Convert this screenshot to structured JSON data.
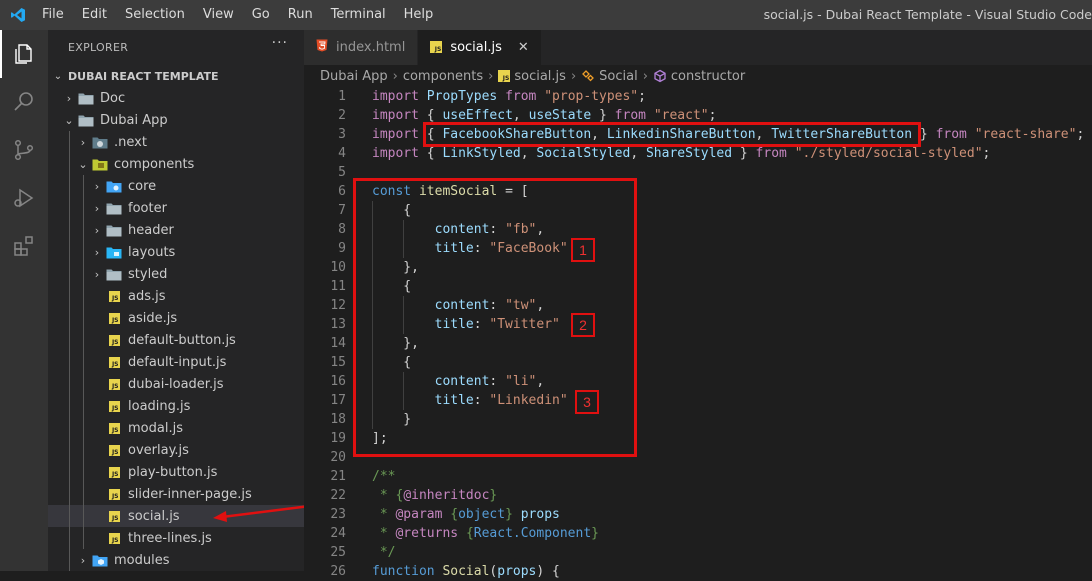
{
  "menu": [
    "File",
    "Edit",
    "Selection",
    "View",
    "Go",
    "Run",
    "Terminal",
    "Help"
  ],
  "window_title": "social.js - Dubai React Template - Visual Studio Code",
  "activity_icons": [
    "explorer-icon",
    "search-icon",
    "source-control-icon",
    "run-debug-icon",
    "extensions-icon"
  ],
  "explorer": {
    "title": "EXPLORER",
    "more": "···",
    "project": "DUBAI REACT TEMPLATE",
    "items": [
      {
        "label": "Doc",
        "type": "folder",
        "level": 0,
        "expanded": false
      },
      {
        "label": "Dubai App",
        "type": "folder",
        "level": 0,
        "expanded": true
      },
      {
        "label": ".next",
        "type": "folder-special",
        "level": 1,
        "expanded": false
      },
      {
        "label": "components",
        "type": "folder-components",
        "level": 1,
        "expanded": true
      },
      {
        "label": "core",
        "type": "folder-core",
        "level": 2,
        "expanded": false
      },
      {
        "label": "footer",
        "type": "folder",
        "level": 2,
        "expanded": false
      },
      {
        "label": "header",
        "type": "folder",
        "level": 2,
        "expanded": false
      },
      {
        "label": "layouts",
        "type": "folder-layouts",
        "level": 2,
        "expanded": false
      },
      {
        "label": "styled",
        "type": "folder",
        "level": 2,
        "expanded": false
      },
      {
        "label": "ads.js",
        "type": "js",
        "level": 2
      },
      {
        "label": "aside.js",
        "type": "js",
        "level": 2
      },
      {
        "label": "default-button.js",
        "type": "js",
        "level": 2
      },
      {
        "label": "default-input.js",
        "type": "js",
        "level": 2
      },
      {
        "label": "dubai-loader.js",
        "type": "js",
        "level": 2
      },
      {
        "label": "loading.js",
        "type": "js",
        "level": 2
      },
      {
        "label": "modal.js",
        "type": "js",
        "level": 2
      },
      {
        "label": "overlay.js",
        "type": "js",
        "level": 2
      },
      {
        "label": "play-button.js",
        "type": "js",
        "level": 2
      },
      {
        "label": "slider-inner-page.js",
        "type": "js",
        "level": 2
      },
      {
        "label": "social.js",
        "type": "js",
        "level": 2,
        "selected": true
      },
      {
        "label": "three-lines.js",
        "type": "js",
        "level": 2
      },
      {
        "label": "modules",
        "type": "folder-modules",
        "level": 1,
        "expanded": false
      }
    ]
  },
  "tabs": [
    {
      "label": "index.html",
      "icon": "html-icon",
      "active": false
    },
    {
      "label": "social.js",
      "icon": "js-icon",
      "active": true,
      "close": "✕"
    }
  ],
  "breadcrumbs": [
    {
      "label": "Dubai App",
      "icon": ""
    },
    {
      "label": "components",
      "icon": ""
    },
    {
      "label": "social.js",
      "icon": "js-icon"
    },
    {
      "label": "Social",
      "icon": "symbol-class-icon"
    },
    {
      "label": "constructor",
      "icon": "symbol-method-icon"
    }
  ],
  "code": [
    {
      "n": "1",
      "i": 0,
      "t": [
        [
          "kw",
          "import "
        ],
        [
          "vr",
          "PropTypes "
        ],
        [
          "kw",
          "from "
        ],
        [
          "st",
          "\"prop-types\""
        ],
        [
          "pn",
          ";"
        ]
      ]
    },
    {
      "n": "2",
      "i": 0,
      "t": [
        [
          "kw",
          "import "
        ],
        [
          "pn",
          "{ "
        ],
        [
          "vr",
          "useEffect"
        ],
        [
          "pn",
          ", "
        ],
        [
          "vr",
          "useState "
        ],
        [
          "pn",
          "} "
        ],
        [
          "kw",
          "from "
        ],
        [
          "st",
          "\"react\""
        ],
        [
          "pn",
          ";"
        ]
      ]
    },
    {
      "n": "3",
      "i": 0,
      "t": [
        [
          "kw",
          "import "
        ],
        [
          "pn",
          "{ "
        ],
        [
          "vr",
          "FacebookShareButton"
        ],
        [
          "pn",
          ", "
        ],
        [
          "vr",
          "LinkedinShareButton"
        ],
        [
          "pn",
          ", "
        ],
        [
          "vr",
          "TwitterShareButton "
        ],
        [
          "pn",
          "} "
        ],
        [
          "kw",
          "from "
        ],
        [
          "st",
          "\"react-share\""
        ],
        [
          "pn",
          ";"
        ]
      ]
    },
    {
      "n": "4",
      "i": 0,
      "t": [
        [
          "kw",
          "import "
        ],
        [
          "pn",
          "{ "
        ],
        [
          "vr",
          "LinkStyled"
        ],
        [
          "pn",
          ", "
        ],
        [
          "vr",
          "SocialStyled"
        ],
        [
          "pn",
          ", "
        ],
        [
          "vr",
          "ShareStyled "
        ],
        [
          "pn",
          "} "
        ],
        [
          "kw",
          "from "
        ],
        [
          "st",
          "\"./styled/social-styled\""
        ],
        [
          "pn",
          ";"
        ]
      ]
    },
    {
      "n": "5",
      "i": 0,
      "t": []
    },
    {
      "n": "6",
      "i": 0,
      "t": [
        [
          "kw2",
          "const "
        ],
        [
          "fn",
          "itemSocial "
        ],
        [
          "pn",
          "= ["
        ]
      ]
    },
    {
      "n": "7",
      "i": 1,
      "t": [
        [
          "pn",
          "    {"
        ]
      ]
    },
    {
      "n": "8",
      "i": 2,
      "t": [
        [
          "vr",
          "        content"
        ],
        [
          "pn",
          ": "
        ],
        [
          "st",
          "\"fb\""
        ],
        [
          "pn",
          ","
        ]
      ]
    },
    {
      "n": "9",
      "i": 2,
      "t": [
        [
          "vr",
          "        title"
        ],
        [
          "pn",
          ": "
        ],
        [
          "st",
          "\"FaceBook\""
        ]
      ]
    },
    {
      "n": "10",
      "i": 1,
      "t": [
        [
          "pn",
          "    },"
        ]
      ]
    },
    {
      "n": "11",
      "i": 1,
      "t": [
        [
          "pn",
          "    {"
        ]
      ]
    },
    {
      "n": "12",
      "i": 2,
      "t": [
        [
          "vr",
          "        content"
        ],
        [
          "pn",
          ": "
        ],
        [
          "st",
          "\"tw\""
        ],
        [
          "pn",
          ","
        ]
      ]
    },
    {
      "n": "13",
      "i": 2,
      "t": [
        [
          "vr",
          "        title"
        ],
        [
          "pn",
          ": "
        ],
        [
          "st",
          "\"Twitter\""
        ]
      ]
    },
    {
      "n": "14",
      "i": 1,
      "t": [
        [
          "pn",
          "    },"
        ]
      ]
    },
    {
      "n": "15",
      "i": 1,
      "t": [
        [
          "pn",
          "    {"
        ]
      ]
    },
    {
      "n": "16",
      "i": 2,
      "t": [
        [
          "vr",
          "        content"
        ],
        [
          "pn",
          ": "
        ],
        [
          "st",
          "\"li\""
        ],
        [
          "pn",
          ","
        ]
      ]
    },
    {
      "n": "17",
      "i": 2,
      "t": [
        [
          "vr",
          "        title"
        ],
        [
          "pn",
          ": "
        ],
        [
          "st",
          "\"Linkedin\""
        ]
      ]
    },
    {
      "n": "18",
      "i": 1,
      "t": [
        [
          "pn",
          "    }"
        ]
      ]
    },
    {
      "n": "19",
      "i": 0,
      "t": [
        [
          "pn",
          "];"
        ]
      ]
    },
    {
      "n": "20",
      "i": 0,
      "t": []
    },
    {
      "n": "21",
      "i": 0,
      "t": [
        [
          "cm",
          "/**"
        ]
      ]
    },
    {
      "n": "22",
      "i": 0,
      "t": [
        [
          "cm",
          " * {"
        ],
        [
          "kw",
          "@inheritdoc"
        ],
        [
          "cm",
          "}"
        ]
      ]
    },
    {
      "n": "23",
      "i": 0,
      "t": [
        [
          "cm",
          " * "
        ],
        [
          "kw",
          "@param "
        ],
        [
          "cm",
          "{"
        ],
        [
          "jt",
          "object"
        ],
        [
          "cm",
          "} "
        ],
        [
          "vr",
          "props"
        ]
      ]
    },
    {
      "n": "24",
      "i": 0,
      "t": [
        [
          "cm",
          " * "
        ],
        [
          "kw",
          "@returns "
        ],
        [
          "cm",
          "{"
        ],
        [
          "jt",
          "React.Component"
        ],
        [
          "cm",
          "}"
        ]
      ]
    },
    {
      "n": "25",
      "i": 0,
      "t": [
        [
          "cm",
          " */"
        ]
      ]
    },
    {
      "n": "26",
      "i": 0,
      "t": [
        [
          "kw2",
          "function "
        ],
        [
          "fn",
          "Social"
        ],
        [
          "pn",
          "("
        ],
        [
          "vr",
          "props"
        ],
        [
          "pn",
          ") {"
        ]
      ]
    }
  ],
  "annotations": [
    "1",
    "2",
    "3"
  ],
  "colors": {
    "annotation_red": "#e01010",
    "accent_blue": "#23a9f2"
  }
}
